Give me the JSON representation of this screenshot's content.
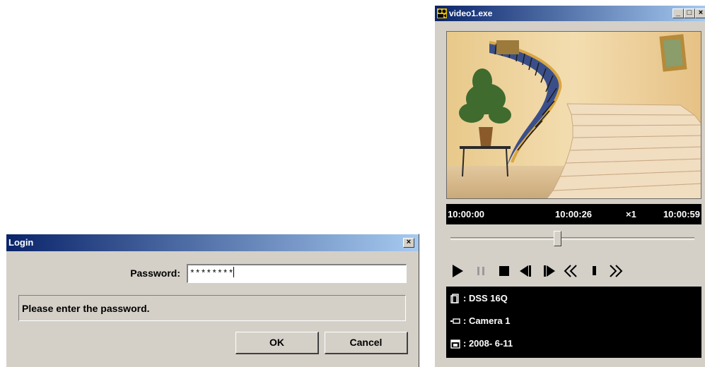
{
  "login_dialog": {
    "title": "Login",
    "close_glyph": "×",
    "password_label": "Password:",
    "password_value": "********",
    "message": "Please enter the password.",
    "ok_label": "OK",
    "cancel_label": "Cancel"
  },
  "video_window": {
    "title": "video1.exe",
    "minimize_glyph": "_",
    "maximize_glyph": "□",
    "close_glyph": "×",
    "time_start": "10:00:00",
    "time_current": "10:00:26",
    "speed": "×1",
    "time_end": "10:00:59",
    "playback_position_fraction": 0.44,
    "controls": [
      "play-icon",
      "pause-icon",
      "stop-icon",
      "step-back-icon",
      "step-forward-icon",
      "rewind-icon",
      "slow-icon",
      "fast-forward-icon"
    ],
    "info": {
      "device": ": DSS 16Q",
      "camera": ": Camera 1",
      "date": ": 2008- 6-11"
    }
  }
}
